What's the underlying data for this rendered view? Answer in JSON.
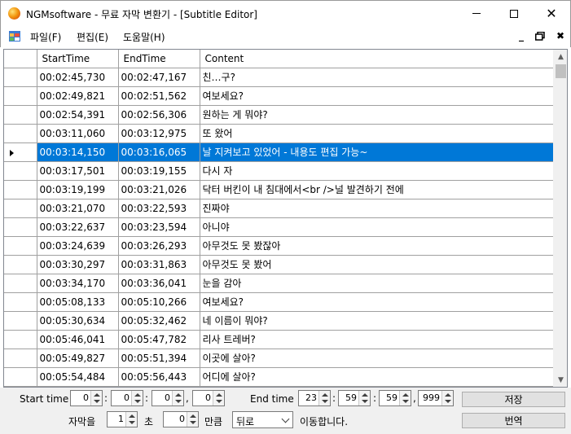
{
  "window": {
    "title": "NGMsoftware - 무료 자막 변환기 - [Subtitle Editor]",
    "icon": "app-logo-icon"
  },
  "menu": {
    "items": [
      "파일(F)",
      "편집(E)",
      "도움말(H)"
    ],
    "mdi_minimize": "_",
    "mdi_close": "✖"
  },
  "grid": {
    "columns": [
      "",
      "StartTime",
      "EndTime",
      "Content"
    ],
    "selected_index": 4,
    "rows": [
      {
        "start": "00:02:45,730",
        "end": "00:02:47,167",
        "content": "친…구?"
      },
      {
        "start": "00:02:49,821",
        "end": "00:02:51,562",
        "content": "여보세요?"
      },
      {
        "start": "00:02:54,391",
        "end": "00:02:56,306",
        "content": "원하는 게 뭐야?"
      },
      {
        "start": "00:03:11,060",
        "end": "00:03:12,975",
        "content": "또 왔어"
      },
      {
        "start": "00:03:14,150",
        "end": "00:03:16,065",
        "content": "날 지켜보고 있었어 - 내용도 편집 가능~"
      },
      {
        "start": "00:03:17,501",
        "end": "00:03:19,155",
        "content": "다시 자"
      },
      {
        "start": "00:03:19,199",
        "end": "00:03:21,026",
        "content": "닥터 버킨이 내 침대에서<br />널 발견하기 전에"
      },
      {
        "start": "00:03:21,070",
        "end": "00:03:22,593",
        "content": "진짜야"
      },
      {
        "start": "00:03:22,637",
        "end": "00:03:23,594",
        "content": "아니야"
      },
      {
        "start": "00:03:24,639",
        "end": "00:03:26,293",
        "content": "아무것도 못 봤잖아"
      },
      {
        "start": "00:03:30,297",
        "end": "00:03:31,863",
        "content": "아무것도 못 봤어"
      },
      {
        "start": "00:03:34,170",
        "end": "00:03:36,041",
        "content": "눈을 감아"
      },
      {
        "start": "00:05:08,133",
        "end": "00:05:10,266",
        "content": "여보세요?"
      },
      {
        "start": "00:05:30,634",
        "end": "00:05:32,462",
        "content": "네 이름이 뭐야?"
      },
      {
        "start": "00:05:46,041",
        "end": "00:05:47,782",
        "content": "리사 트레버?"
      },
      {
        "start": "00:05:49,827",
        "end": "00:05:51,394",
        "content": "이곳에 살아?"
      },
      {
        "start": "00:05:54,484",
        "end": "00:05:56,443",
        "content": "어디에 살아?"
      }
    ]
  },
  "controls": {
    "start_time_label": "Start time",
    "start_time": {
      "h": "0",
      "m": "0",
      "s": "0",
      "ms": "0"
    },
    "end_time_label": "End time",
    "end_time": {
      "h": "23",
      "m": "59",
      "s": "59",
      "ms": "999"
    },
    "sep_colon": ":",
    "sep_comma": ",",
    "save_label": "저장",
    "subtitle_label": "자막을",
    "subtitle_count": "1",
    "seconds_label": "초",
    "seconds_value": "0",
    "amount_label": "만큼",
    "direction": "뒤로",
    "move_label": "이동합니다.",
    "translate_label": "번역"
  },
  "colors": {
    "selection": "#0078d7",
    "control_bg": "#f0f0f0"
  }
}
